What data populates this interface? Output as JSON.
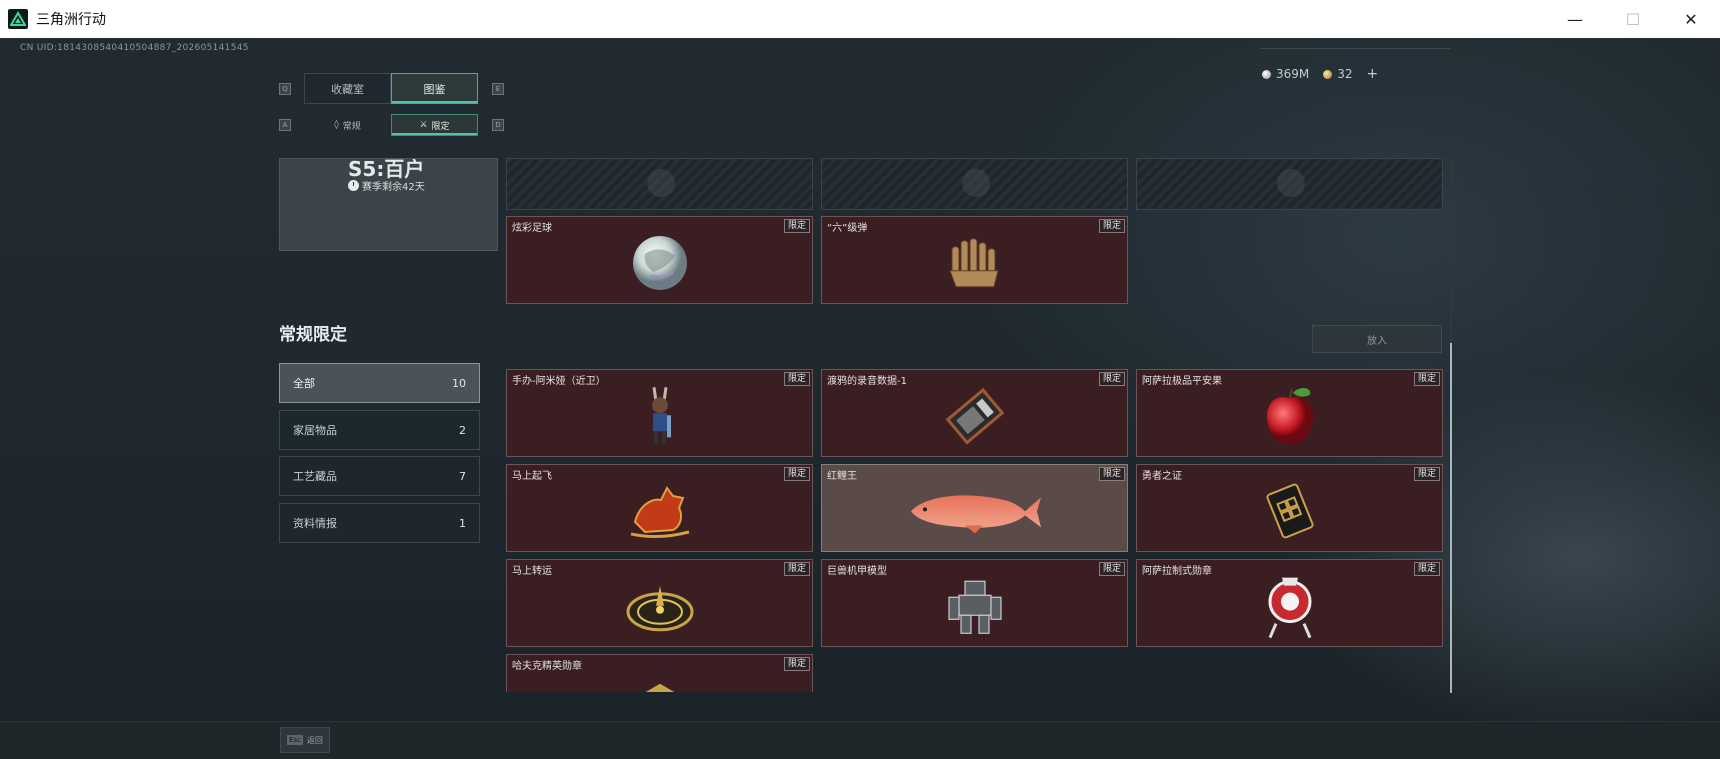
{
  "window": {
    "title": "三角洲行动",
    "minimize": "—",
    "maximize": "☐",
    "close": "✕"
  },
  "uid": "CN UID:1814308540410504887_202605141545",
  "currency": {
    "silver": "369M",
    "gold": "32",
    "add": "+"
  },
  "keys": {
    "q": "Q",
    "e": "E",
    "a": "A",
    "d": "D"
  },
  "tabs": {
    "main": [
      {
        "label": "收藏室",
        "active": false
      },
      {
        "label": "图鉴",
        "active": true
      }
    ],
    "sub": [
      {
        "label": "常规",
        "active": false,
        "icon": "flame-icon"
      },
      {
        "label": "限定",
        "active": true,
        "icon": "crossed-swords-icon"
      }
    ]
  },
  "season": {
    "big_text": "S5:百户",
    "remaining": "赛季剩余42天"
  },
  "top_cards": [
    {
      "name": "炫彩足球",
      "tag": "限定",
      "art": "soccer-ball-icon"
    },
    {
      "name": "“六”级弹",
      "tag": "限定",
      "art": "bullet-hand-icon"
    }
  ],
  "section": {
    "title": "常规限定",
    "put_button": "放入"
  },
  "filters": [
    {
      "label": "全部",
      "count": "10",
      "active": true
    },
    {
      "label": "家居物品",
      "count": "2",
      "active": false
    },
    {
      "label": "工艺藏品",
      "count": "7",
      "active": false
    },
    {
      "label": "资料情报",
      "count": "1",
      "active": false
    }
  ],
  "cards": [
    {
      "name": "手办-阿米娅（近卫）",
      "tag": "限定",
      "art": "figure-icon"
    },
    {
      "name": "渡鸦的录音数据-1",
      "tag": "限定",
      "art": "data-chip-icon"
    },
    {
      "name": "阿萨拉极品平安果",
      "tag": "限定",
      "art": "apple-icon"
    },
    {
      "name": "马上起飞",
      "tag": "限定",
      "art": "horse-icon"
    },
    {
      "name": "红鲤王",
      "tag": "限定",
      "art": "fish-icon",
      "selected": true
    },
    {
      "name": "勇者之证",
      "tag": "限定",
      "art": "card-badge-icon"
    },
    {
      "name": "马上转运",
      "tag": "限定",
      "art": "compass-icon"
    },
    {
      "name": "巨兽机甲模型",
      "tag": "限定",
      "art": "mech-icon"
    },
    {
      "name": "阿萨拉制式勋章",
      "tag": "限定",
      "art": "medal-icon"
    },
    {
      "name": "哈夫克精英勋章",
      "tag": "限定",
      "art": "elite-medal-icon"
    }
  ],
  "footer": {
    "esc_key": "Esc",
    "back_label": "返回"
  }
}
